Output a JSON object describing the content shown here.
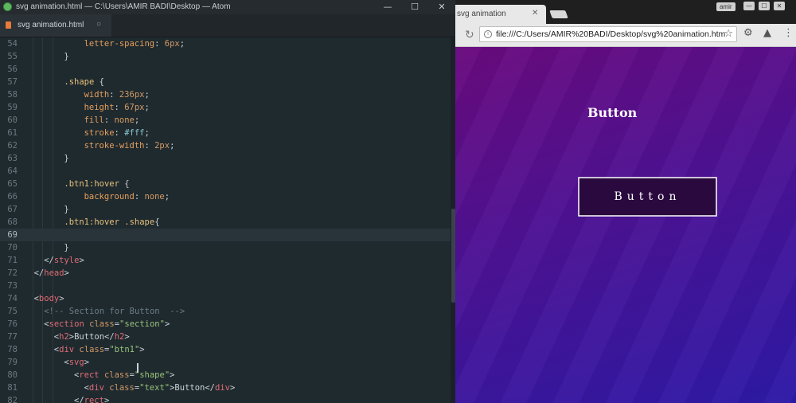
{
  "atom": {
    "title": "svg animation.html — C:\\Users\\AMIR BADI\\Desktop — Atom",
    "window_buttons": [
      "—",
      "☐",
      "✕"
    ],
    "tab_label": "svg animation.html",
    "tab_close": "○",
    "cursor_line": "69",
    "lines": [
      {
        "n": "54",
        "indent": 6,
        "tokens": [
          [
            "prop",
            "letter-spacing"
          ],
          [
            "pun",
            ": "
          ],
          [
            "num",
            "6px"
          ],
          [
            "pun",
            ";"
          ]
        ]
      },
      {
        "n": "55",
        "indent": 4,
        "tokens": [
          [
            "pun",
            "}"
          ]
        ]
      },
      {
        "n": "56",
        "indent": 0,
        "tokens": []
      },
      {
        "n": "57",
        "indent": 4,
        "tokens": [
          [
            "sel",
            ".shape"
          ],
          [
            "pun",
            " {"
          ]
        ]
      },
      {
        "n": "58",
        "indent": 6,
        "tokens": [
          [
            "prop",
            "width"
          ],
          [
            "pun",
            ": "
          ],
          [
            "num",
            "236px"
          ],
          [
            "pun",
            ";"
          ]
        ]
      },
      {
        "n": "59",
        "indent": 6,
        "tokens": [
          [
            "prop",
            "height"
          ],
          [
            "pun",
            ": "
          ],
          [
            "num",
            "67px"
          ],
          [
            "pun",
            ";"
          ]
        ]
      },
      {
        "n": "60",
        "indent": 6,
        "tokens": [
          [
            "prop",
            "fill"
          ],
          [
            "pun",
            ": "
          ],
          [
            "val",
            "none"
          ],
          [
            "pun",
            ";"
          ]
        ]
      },
      {
        "n": "61",
        "indent": 6,
        "tokens": [
          [
            "prop",
            "stroke"
          ],
          [
            "pun",
            ": "
          ],
          [
            "hex",
            "#fff"
          ],
          [
            "pun",
            ";"
          ]
        ]
      },
      {
        "n": "62",
        "indent": 6,
        "tokens": [
          [
            "prop",
            "stroke-width"
          ],
          [
            "pun",
            ": "
          ],
          [
            "num",
            "2px"
          ],
          [
            "pun",
            ";"
          ]
        ]
      },
      {
        "n": "63",
        "indent": 4,
        "tokens": [
          [
            "pun",
            "}"
          ]
        ]
      },
      {
        "n": "64",
        "indent": 0,
        "tokens": []
      },
      {
        "n": "65",
        "indent": 4,
        "tokens": [
          [
            "sel",
            ".btn1:hover"
          ],
          [
            "pun",
            " {"
          ]
        ]
      },
      {
        "n": "66",
        "indent": 6,
        "tokens": [
          [
            "prop",
            "background"
          ],
          [
            "pun",
            ": "
          ],
          [
            "val",
            "none"
          ],
          [
            "pun",
            ";"
          ]
        ]
      },
      {
        "n": "67",
        "indent": 4,
        "tokens": [
          [
            "pun",
            "}"
          ]
        ]
      },
      {
        "n": "68",
        "indent": 4,
        "tokens": [
          [
            "sel",
            ".btn1:hover .shape"
          ],
          [
            "pun",
            "{"
          ]
        ]
      },
      {
        "n": "69",
        "indent": 0,
        "tokens": []
      },
      {
        "n": "70",
        "indent": 4,
        "tokens": [
          [
            "pun",
            "}"
          ]
        ]
      },
      {
        "n": "71",
        "indent": 2,
        "tokens": [
          [
            "pun",
            "</"
          ],
          [
            "tag",
            "style"
          ],
          [
            "pun",
            ">"
          ]
        ]
      },
      {
        "n": "72",
        "indent": 1,
        "tokens": [
          [
            "pun",
            "</"
          ],
          [
            "tag",
            "head"
          ],
          [
            "pun",
            ">"
          ]
        ]
      },
      {
        "n": "73",
        "indent": 0,
        "tokens": []
      },
      {
        "n": "74",
        "indent": 1,
        "tokens": [
          [
            "pun",
            "<"
          ],
          [
            "tag",
            "body"
          ],
          [
            "pun",
            ">"
          ]
        ]
      },
      {
        "n": "75",
        "indent": 2,
        "tokens": [
          [
            "com",
            "<!-- Section for Button  -->"
          ]
        ]
      },
      {
        "n": "76",
        "indent": 2,
        "tokens": [
          [
            "pun",
            "<"
          ],
          [
            "tag",
            "section"
          ],
          [
            "pun",
            " "
          ],
          [
            "attr",
            "class"
          ],
          [
            "pun",
            "="
          ],
          [
            "str",
            "\"section\""
          ],
          [
            "pun",
            ">"
          ]
        ]
      },
      {
        "n": "77",
        "indent": 3,
        "tokens": [
          [
            "pun",
            "<"
          ],
          [
            "tag",
            "h2"
          ],
          [
            "pun",
            ">"
          ],
          [
            "txt",
            "Button"
          ],
          [
            "pun",
            "</"
          ],
          [
            "tag",
            "h2"
          ],
          [
            "pun",
            ">"
          ]
        ]
      },
      {
        "n": "78",
        "indent": 3,
        "tokens": [
          [
            "pun",
            "<"
          ],
          [
            "tag",
            "div"
          ],
          [
            "pun",
            " "
          ],
          [
            "attr",
            "class"
          ],
          [
            "pun",
            "="
          ],
          [
            "str",
            "\"btn1\""
          ],
          [
            "pun",
            ">"
          ]
        ]
      },
      {
        "n": "79",
        "indent": 4,
        "tokens": [
          [
            "pun",
            "<"
          ],
          [
            "tag",
            "svg"
          ],
          [
            "pun",
            ">"
          ]
        ]
      },
      {
        "n": "80",
        "indent": 5,
        "tokens": [
          [
            "pun",
            "<"
          ],
          [
            "tag",
            "rect"
          ],
          [
            "pun",
            " "
          ],
          [
            "attr",
            "class"
          ],
          [
            "pun",
            "="
          ],
          [
            "str",
            "\"shape\""
          ],
          [
            "pun",
            ">"
          ]
        ]
      },
      {
        "n": "81",
        "indent": 6,
        "tokens": [
          [
            "pun",
            "<"
          ],
          [
            "tag",
            "div"
          ],
          [
            "pun",
            " "
          ],
          [
            "attr",
            "class"
          ],
          [
            "pun",
            "="
          ],
          [
            "str",
            "\"text\""
          ],
          [
            "pun",
            ">"
          ],
          [
            "txt",
            "Button"
          ],
          [
            "pun",
            "</"
          ],
          [
            "tag",
            "div"
          ],
          [
            "pun",
            ">"
          ]
        ]
      },
      {
        "n": "82",
        "indent": 5,
        "tokens": [
          [
            "pun",
            "</"
          ],
          [
            "tag",
            "rect"
          ],
          [
            "pun",
            ">"
          ]
        ]
      }
    ]
  },
  "chrome": {
    "tab_label": "svg animation",
    "tab_close": "✕",
    "user_label": "amir",
    "window_buttons": [
      "—",
      "☐",
      "✕"
    ],
    "url": "file:///C:/Users/AMIR%20BADI/Desktop/svg%20animation.htm",
    "reload_glyph": "↻",
    "info_glyph": "i",
    "star_glyph": "☆",
    "ext_gear": "⚙",
    "ext_drive": "▲",
    "menu_glyph": "⋮"
  },
  "page": {
    "heading": "Button",
    "button_text": "Button"
  },
  "colors": {
    "page_gradient_start": "#6a0a7e",
    "page_gradient_end": "#2d1aa7",
    "button_fill": "#2a0a3e",
    "button_stroke": "#ffffff"
  }
}
